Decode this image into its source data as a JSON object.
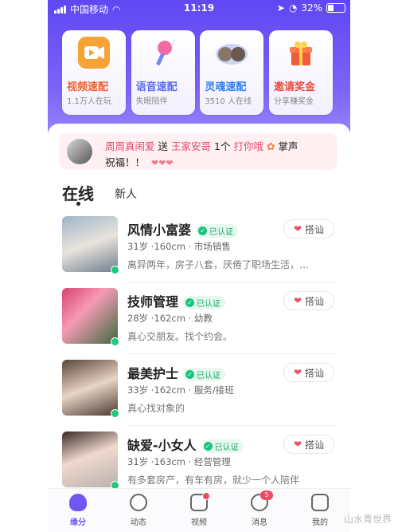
{
  "status_bar": {
    "carrier": "中国移动",
    "time": "11:19",
    "battery": "32%"
  },
  "quick_actions": [
    {
      "title": "视频速配",
      "subtitle": "1.1万人在玩",
      "color": "#f0612f",
      "icon": "video-camera-icon"
    },
    {
      "title": "语音速配",
      "subtitle": "失眠陪伴",
      "color": "#5b6cf0",
      "icon": "microphone-icon"
    },
    {
      "title": "灵魂速配",
      "subtitle": "3510 人在线",
      "color": "#2f7ef0",
      "icon": "avatar-pair-icon"
    },
    {
      "title": "邀请奖金",
      "subtitle": "分享赚奖金",
      "color": "#f04a3c",
      "icon": "gift-box-icon"
    }
  ],
  "gift_banner": {
    "sender": "周周真闹爱",
    "verb": "送",
    "receiver": "王家安哥",
    "count": "1个",
    "gift_name": "打你哦",
    "line1_suffix": "掌声",
    "line2": "祝福！！"
  },
  "tabs": {
    "online": "在线",
    "new": "新人"
  },
  "users": [
    {
      "name": "风情小富婆",
      "verified": "已认证",
      "meta": "31岁 ·160cm · 市场销售",
      "bio": "离异两年，房子八套，厌倦了职场生活，…",
      "action": "搭讪"
    },
    {
      "name": "技师管理",
      "verified": "已认证",
      "meta": "28岁 ·162cm · 幼教",
      "bio": "真心交朋友。找个约会。",
      "action": "搭讪"
    },
    {
      "name": "最美护士",
      "verified": "已认证",
      "meta": "33岁 ·162cm · 服务/接班",
      "bio": "真心找对象的",
      "action": "搭讪"
    },
    {
      "name": "缺爱-小女人",
      "verified": "已认证",
      "meta": "31岁 ·163cm · 经营管理",
      "bio": "有多套房产，有车有房，就少一个人陪伴",
      "action": "搭讪"
    }
  ],
  "bottom_nav": [
    {
      "label": "缘分",
      "icon": "heart-icon"
    },
    {
      "label": "动态",
      "icon": "compass-icon"
    },
    {
      "label": "视频",
      "icon": "video-icon"
    },
    {
      "label": "消息",
      "icon": "chat-bubble-icon",
      "badge": "5"
    },
    {
      "label": "我的",
      "icon": "profile-icon"
    }
  ],
  "watermark": "山水青世界",
  "colors": {
    "primary": "#6f57f5",
    "accent_red": "#e84668",
    "verified_green": "#19a56a",
    "online_green": "#1ecb7a"
  }
}
